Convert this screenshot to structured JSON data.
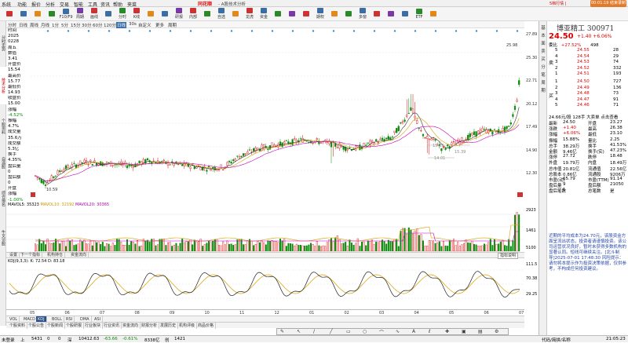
{
  "menubar": {
    "items": [
      "系统",
      "功能",
      "报价",
      "分析",
      "交易",
      "智能",
      "工具",
      "资讯",
      "帮助",
      "夹菜"
    ],
    "logo": "同花顺",
    "title": "- A股技术分析",
    "notify": "5档行情 |",
    "timer": "00:01:19 结束录制"
  },
  "toolbar": {
    "buttons": [
      "",
      "",
      "",
      "",
      "F10/F9",
      "周期",
      "画线",
      "",
      "分时",
      "K线",
      "",
      "",
      "研报",
      "内部",
      "",
      "自选",
      "",
      "龙虎",
      "资金",
      "",
      "",
      "",
      "期权",
      "",
      "",
      "多窗",
      "",
      "",
      "",
      "ETF",
      ""
    ]
  },
  "left_tabs": [
    "分时走势",
    "技术分析",
    "个股资料",
    "自选股",
    "综合排名",
    "牛叉诊股"
  ],
  "period_bar": {
    "items": [
      "分时",
      "日线",
      "周线",
      "月线",
      "1分",
      "5分",
      "15分",
      "30分",
      "60分",
      "120分",
      "日线",
      "30s",
      "自定义",
      "更多",
      "周期"
    ]
  },
  "info_col": {
    "lines": [
      "时间",
      "2025",
      "0228",
      "周五",
      "数值",
      "3.41",
      "开盘价",
      "15.54",
      "最高价",
      "15.77",
      "最低价",
      "14.93",
      "收盘价",
      "15.00",
      "涨幅",
      "-4.52%",
      "振幅",
      "4.7%",
      "成交量",
      "35.6万",
      "成交额",
      "5.3亿",
      "换手",
      "4.35%",
      "盘后量",
      "0",
      "盘后额",
      "0",
      "开盘",
      "涨幅",
      "-1.00%"
    ]
  },
  "price_axis": [
    "27.89",
    "25.30",
    "22.71",
    "20.12",
    "17.49",
    "14.90",
    "12.30"
  ],
  "chart_labels": {
    "high_label": "25.98",
    "low_label": "10.59",
    "mid_label_1": "15.29",
    "mid_label_2": "15.39",
    "mid_label_3": "14.01"
  },
  "volume": {
    "label_ma5": "MAVOL5: 35323",
    "label_ma10": "MAVOL10: 32192",
    "label_ma20": "MAVOL20: 30365",
    "axis": [
      "2923",
      "1461",
      "5100"
    ]
  },
  "sub_tabs": [
    "设置",
    "下一个指标",
    "机构持仓",
    "资金流向"
  ],
  "indicator_btn": "指标说明",
  "kdj": {
    "label": "KDJ(9,3,3): K: 72.54  D: 83.18",
    "axis": [
      "111.5",
      "70.38",
      "29.25"
    ]
  },
  "date_axis": [
    "05",
    "06",
    "07",
    "08",
    "09",
    "10",
    "11",
    "12",
    "01",
    "02",
    "03",
    "04",
    "05",
    "06",
    "07"
  ],
  "ind_tabs": [
    "VOL",
    "MACD",
    "KDJ",
    "BOLL",
    "RSI",
    "DMA",
    "ASI"
  ],
  "bottom_tabs": [
    "个股资料",
    "个股公告",
    "个股新闻",
    "个股研报",
    "行业板块",
    "行业资讯",
    "资金流向",
    "财报分析",
    "发展历史",
    "机构评级",
    "商品价格"
  ],
  "draw_toolbar": [
    "✎",
    "↖",
    "/",
    "╱",
    "▭",
    "○",
    "⌒",
    "∿",
    "A",
    "ℓ",
    "✚",
    "▣",
    "▤",
    "⚙"
  ],
  "statusbar": {
    "items": [
      "未登录",
      "上",
      "5431",
      "0",
      "0",
      "深",
      "10412.63",
      "-63.66",
      "-0.61%",
      "8338亿",
      "创",
      "1421",
      "",
      "",
      "",
      "",
      "",
      "代码/简拼/名称",
      "21:05:23"
    ]
  },
  "right_panel": {
    "side_tabs": [
      "基",
      "本",
      "面",
      "卖",
      "买",
      "分",
      "笔",
      "周",
      "期"
    ],
    "stock_name": "博亚精工 300971",
    "price": "24.50",
    "change": "+1.40  +6.06%",
    "weibi_label": "委比",
    "weibi": "+27.52%",
    "weicha": "498",
    "asks": [
      {
        "level": "5",
        "price": "24.55",
        "vol": "28"
      },
      {
        "level": "4",
        "price": "24.54",
        "vol": "29"
      },
      {
        "level": "3",
        "price": "24.53",
        "vol": "74"
      },
      {
        "level": "2",
        "price": "24.52",
        "vol": "332"
      },
      {
        "level": "1",
        "price": "24.51",
        "vol": "193"
      }
    ],
    "bids": [
      {
        "level": "1",
        "price": "24.50",
        "vol": "727"
      },
      {
        "level": "2",
        "price": "24.49",
        "vol": "136"
      },
      {
        "level": "3",
        "price": "24.48",
        "vol": "73"
      },
      {
        "level": "4",
        "price": "24.47",
        "vol": "91"
      },
      {
        "level": "5",
        "price": "24.46",
        "vol": "71"
      }
    ],
    "ask_label": "卖",
    "bid_label": "买",
    "header_stat": "24.66元/股  128手  大卖单  点击查看",
    "stats": [
      [
        "最新",
        "24.50",
        "开盘",
        "23.27"
      ],
      [
        "涨跌",
        "+1.40",
        "最高",
        "26.38"
      ],
      [
        "涨幅",
        "+6.06%",
        "最低",
        "23.10"
      ],
      [
        "振幅",
        "15.88%",
        "量比",
        "2.25"
      ],
      [
        "总手",
        "38.29万",
        "换手",
        "41.53%"
      ],
      [
        "金额",
        "9.46亿",
        "换手(实)",
        "47.23%"
      ],
      [
        "涨停",
        "27.72",
        "跌停",
        "18.48"
      ],
      [
        "外盘",
        "19.79万",
        "内盘",
        "18.49万"
      ],
      [
        "总市值",
        "20.81亿",
        "流通值",
        "22.56亿"
      ],
      [
        "总股本",
        "0.86亿",
        "流通股",
        "9206万"
      ],
      [
        "市盈(动)",
        "65.79",
        "市盈(TTM)",
        "91.14"
      ],
      [
        "盘后量",
        "9",
        "盘后额",
        "21050"
      ],
      [
        "盘后笔数",
        "1",
        "总笔数",
        "是"
      ]
    ],
    "news": "近期的平均成本为24.70元，该股资金方面呈流出状态，投资者请谨慎投资。该公司运营状况良好，暂时未获得多数机构的显著认同。短线可继续关注。[北斗制导]2025-07-01 17:48:30 风险提示：请勿将本提示作为投资决策依据，仅供参考，不构成任何投资建议。"
  },
  "colors": {
    "up": "#d00000",
    "down": "#0a8a0a",
    "accent": "#3a6ea5",
    "timer_bg": "#e07a2c"
  }
}
